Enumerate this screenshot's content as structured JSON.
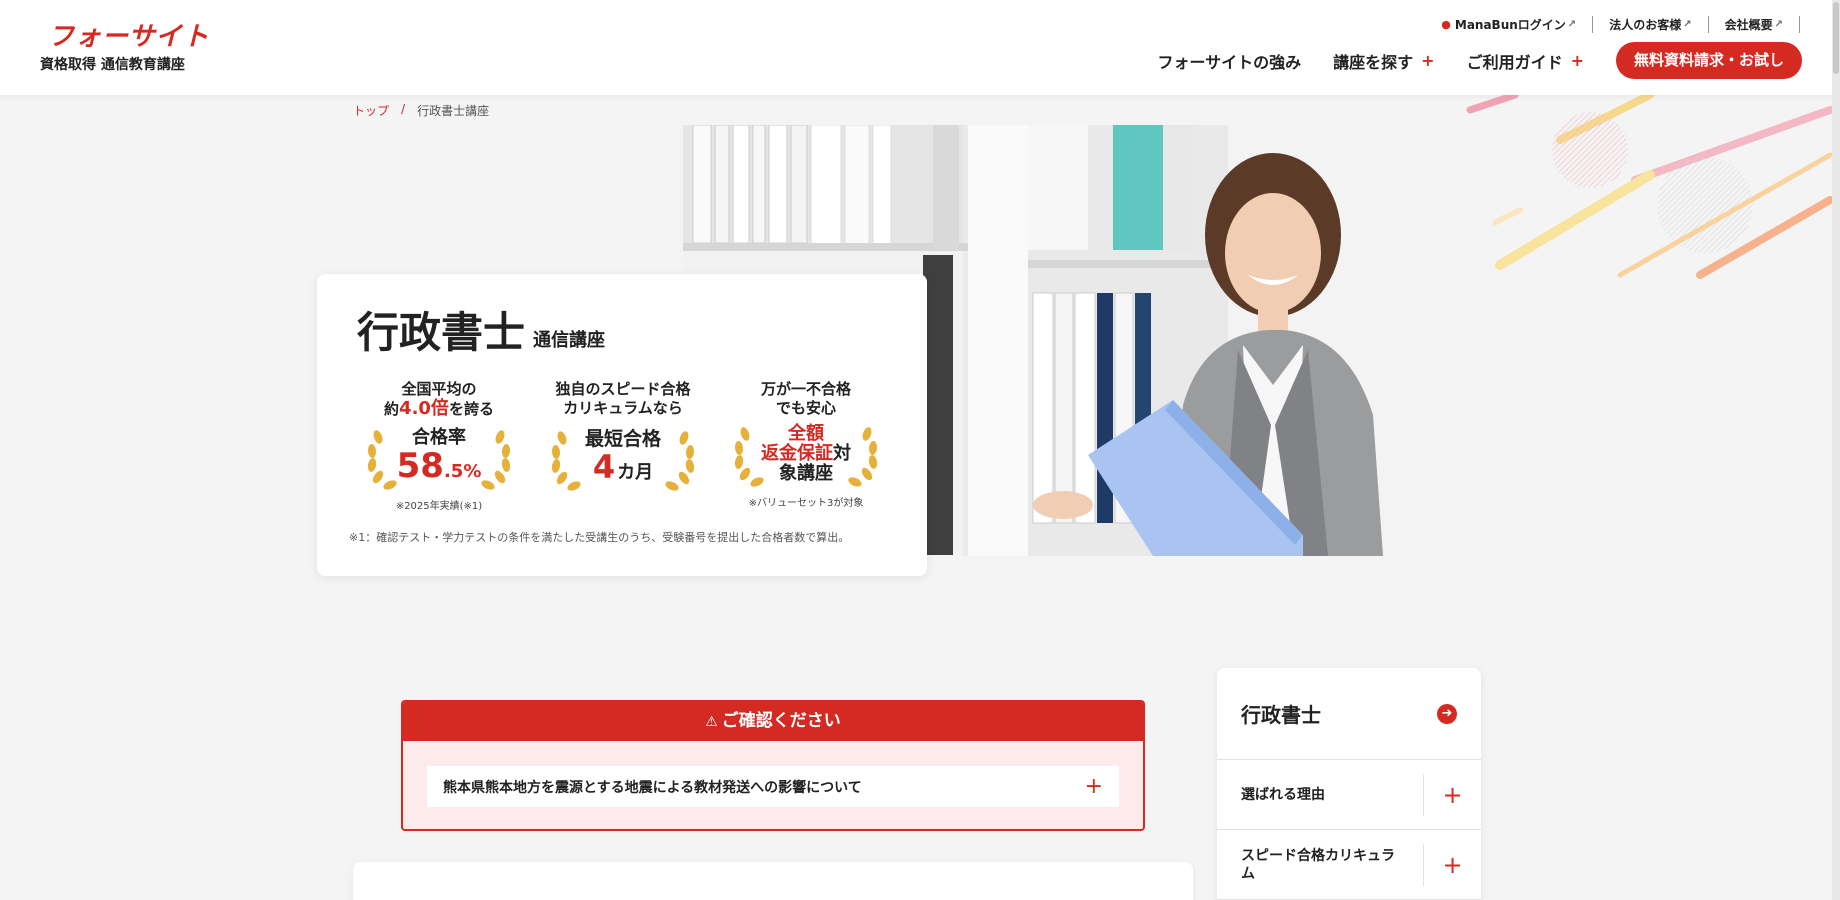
{
  "header": {
    "logo_main": "フォーサイト",
    "logo_sub": "資格取得 通信教育講座",
    "utility": [
      {
        "label": "ManaBunログイン",
        "icon": "person-icon"
      },
      {
        "label": "法人のお客様"
      },
      {
        "label": "会社概要"
      }
    ],
    "nav": [
      {
        "label": "フォーサイトの強み",
        "has_plus": false
      },
      {
        "label": "講座を探す",
        "has_plus": true
      },
      {
        "label": "ご利用ガイド",
        "has_plus": true
      }
    ],
    "cta_label": "無料資料請求・お試し"
  },
  "breadcrumb": {
    "home": "トップ",
    "separator": "/",
    "current": "行政書士講座"
  },
  "hero": {
    "title": "行政書士",
    "subtitle": "通信講座",
    "features": [
      {
        "caption_line1": "全国平均の",
        "caption_line2_pre": "約",
        "caption_line2_red": "4.0倍",
        "caption_line2_post": "を誇る",
        "badge_label": "合格率",
        "badge_value_big": "58",
        "badge_value_small": ".5%",
        "note": "※2025年実績(※1)"
      },
      {
        "caption_line1": "独自のスピード合格",
        "caption_line2": "カリキュラムなら",
        "badge_label": "最短合格",
        "badge_value_big": "4",
        "badge_value_small": "カ月"
      },
      {
        "caption_line1": "万が一不合格",
        "caption_line2": "でも安心",
        "badge_red1": "全額",
        "badge_red2": "返金保証",
        "badge_post2": "対",
        "badge_line3": "象講座",
        "note": "※バリューセット3が対象"
      }
    ],
    "footnote": "※1：確認テスト・学力テストの条件を満たした受講生のうち、受験番号を提出した合格者数で算出。"
  },
  "notice": {
    "title": "ご確認ください",
    "item": "熊本県熊本地方を震源とする地震による教材発送への影響について"
  },
  "sidenav": {
    "title": "行政書士",
    "items": [
      {
        "label": "選ばれる理由"
      },
      {
        "label": "スピード合格カリキュラム"
      }
    ]
  },
  "colors": {
    "brand_red": "#d52a22",
    "background": "#f4f4f4",
    "wreath_gold": "#e6b13a"
  }
}
